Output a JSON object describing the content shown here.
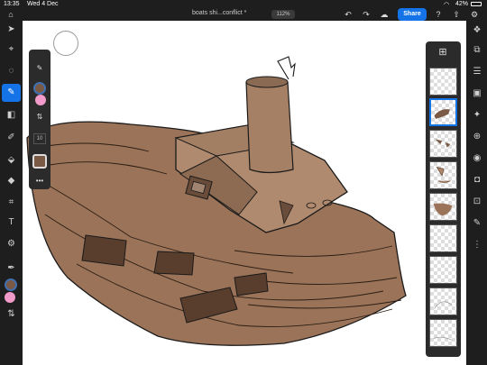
{
  "status": {
    "time": "13:35",
    "date": "Wed 4 Dec",
    "battery": "42%"
  },
  "document": {
    "title": "boats shi...conflict *",
    "zoom": "112%"
  },
  "toolbar": {
    "share_label": "Share"
  },
  "brush": {
    "size": "10"
  },
  "colors": {
    "foreground": "#7a5a45",
    "background": "#f29ac9",
    "accent": "#1473e6"
  },
  "left_tools": [
    "home-icon",
    "select-icon",
    "transform-icon",
    "lasso-icon",
    "brush-icon",
    "eraser-icon",
    "smudge-icon",
    "fill-icon",
    "crop-icon",
    "text-icon",
    "adjust-icon",
    "eyedropper-icon",
    "swap-icon"
  ],
  "right_tools": [
    "settings-icon",
    "layers-icon",
    "layer-properties-icon",
    "adjustments-icon",
    "image-icon",
    "add-layer-icon",
    "visibility-icon",
    "mask-icon",
    "clip-icon",
    "edit-icon",
    "more-icon"
  ],
  "layers": {
    "count": 9,
    "selected_index": 1
  }
}
